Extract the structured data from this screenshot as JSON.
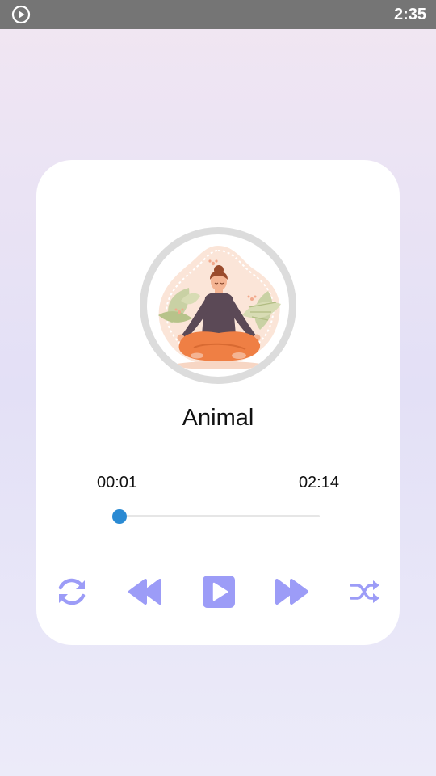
{
  "status_bar": {
    "time": "2:35",
    "indicator_icon": "play-circle-icon"
  },
  "player": {
    "title": "Animal",
    "current_time": "00:01",
    "total_time": "02:14",
    "progress": 0.0075,
    "artwork": "meditating-woman-illustration"
  },
  "controls": {
    "repeat_icon": "repeat-icon",
    "previous_icon": "rewind-icon",
    "play_icon": "play-icon",
    "next_icon": "fast-forward-icon",
    "shuffle_icon": "shuffle-icon"
  },
  "colors": {
    "accent": "#9c9cf7",
    "seek_accent": "#2a8ad3",
    "status_bar": "#757575"
  }
}
